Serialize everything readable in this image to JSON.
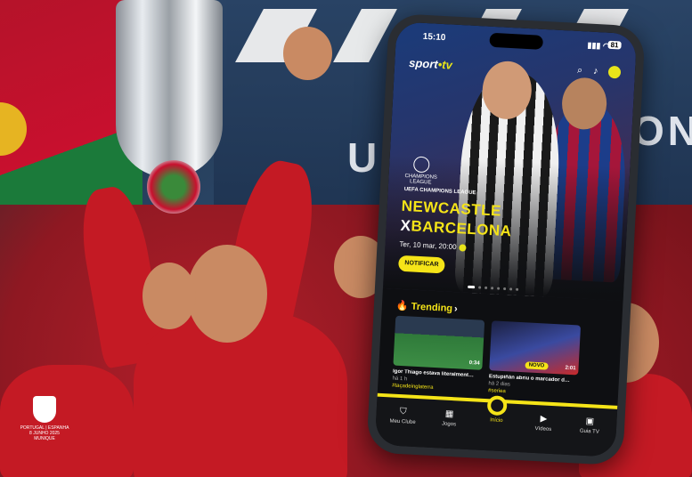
{
  "colors": {
    "accent": "#f5e418",
    "dark": "#0e0f12"
  },
  "background": {
    "banner_text": "UE",
    "banner_text_right": "ON",
    "badge_lines": [
      "PORTUGAL | ESPANHA",
      "8 JUNHO 2025",
      "MUNIQUE"
    ]
  },
  "status_bar": {
    "time": "15:10",
    "battery": "81"
  },
  "app": {
    "logo_main": "sport",
    "logo_accent": "•tv",
    "header_icons": [
      "search-icon",
      "bell-icon",
      "profile-icon"
    ]
  },
  "hero": {
    "competition_badge": "CHAMPIONS LEAGUE",
    "competition": "UEFA CHAMPIONS LEAGUE",
    "team_home": "NEWCASTLE",
    "team_away_prefix": "X",
    "team_away": "BARCELONA",
    "datetime": "Ter, 10 mar, 20:00",
    "notify_label": "NOTIFICAR"
  },
  "trending": {
    "title": "Trending",
    "items": [
      {
        "title": "Igor Thiago estava literalment…",
        "ago": "há 1 h",
        "tag": "",
        "duration": "0:34",
        "hashtag": "#taçadeinglaterra"
      },
      {
        "title": "Estupiñán abriu o marcador d…",
        "ago": "há 2 dias",
        "tag": "NOVO",
        "duration": "2:01",
        "hashtag": "#seriea"
      }
    ]
  },
  "nav": [
    {
      "label": "Meu Clube",
      "icon": "shield-icon"
    },
    {
      "label": "Jogos",
      "icon": "grid-icon"
    },
    {
      "label": "Início",
      "icon": "home-icon"
    },
    {
      "label": "Vídeos",
      "icon": "play-icon"
    },
    {
      "label": "Guia TV",
      "icon": "tv-icon"
    }
  ]
}
